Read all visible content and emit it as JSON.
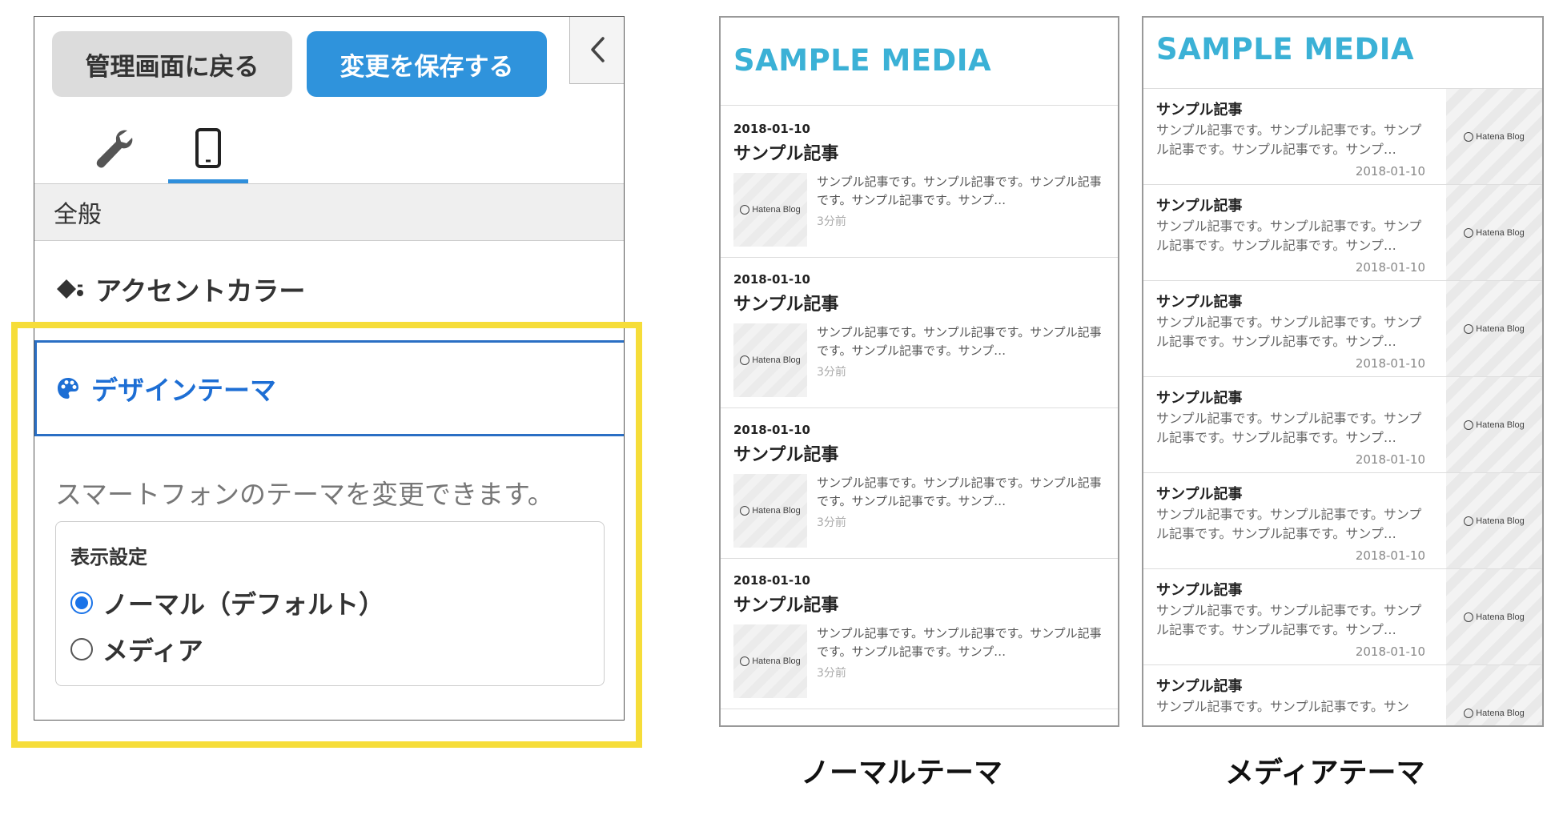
{
  "settings": {
    "back_label": "管理画面に戻る",
    "save_label": "変更を保存する",
    "tabs": [
      "wrench-icon",
      "smartphone-icon"
    ],
    "section_general": "全般",
    "accent_label": "アクセントカラー",
    "theme_label": "デザインテーマ",
    "theme_description": "スマートフォンのテーマを変更できます。",
    "display_title": "表示設定",
    "options": [
      {
        "label": "ノーマル（デフォルト）",
        "selected": true
      },
      {
        "label": "メディア",
        "selected": false
      }
    ],
    "colors": {
      "save": "#2f93dc",
      "active_tab": "#2f8fdc",
      "theme_border": "#2a6fc4",
      "highlight": "#f6dd39"
    }
  },
  "preview": {
    "brand": "SAMPLE MEDIA",
    "brand_color": "#3bb1d6",
    "normal": {
      "caption": "ノーマルテーマ",
      "items": [
        {
          "date": "2018-01-10",
          "title": "サンプル記事",
          "excerpt": "サンプル記事です。サンプル記事です。サンプル記事です。サンプル記事です。サンプ…",
          "ago": "3分前",
          "thumb": "Hatena Blog"
        },
        {
          "date": "2018-01-10",
          "title": "サンプル記事",
          "excerpt": "サンプル記事です。サンプル記事です。サンプル記事です。サンプル記事です。サンプ…",
          "ago": "3分前",
          "thumb": "Hatena Blog"
        },
        {
          "date": "2018-01-10",
          "title": "サンプル記事",
          "excerpt": "サンプル記事です。サンプル記事です。サンプル記事です。サンプル記事です。サンプ…",
          "ago": "3分前",
          "thumb": "Hatena Blog"
        },
        {
          "date": "2018-01-10",
          "title": "サンプル記事",
          "excerpt": "サンプル記事です。サンプル記事です。サンプル記事です。サンプル記事です。サンプ…",
          "ago": "3分前",
          "thumb": "Hatena Blog"
        }
      ]
    },
    "media": {
      "caption": "メディアテーマ",
      "items": [
        {
          "title": "サンプル記事",
          "excerpt": "サンプル記事です。サンプル記事です。サンプル記事です。サンプル記事です。サンプ…",
          "date": "2018-01-10",
          "thumb": "Hatena Blog"
        },
        {
          "title": "サンプル記事",
          "excerpt": "サンプル記事です。サンプル記事です。サンプル記事です。サンプル記事です。サンプ…",
          "date": "2018-01-10",
          "thumb": "Hatena Blog"
        },
        {
          "title": "サンプル記事",
          "excerpt": "サンプル記事です。サンプル記事です。サンプル記事です。サンプル記事です。サンプ…",
          "date": "2018-01-10",
          "thumb": "Hatena Blog"
        },
        {
          "title": "サンプル記事",
          "excerpt": "サンプル記事です。サンプル記事です。サンプル記事です。サンプル記事です。サンプ…",
          "date": "2018-01-10",
          "thumb": "Hatena Blog"
        },
        {
          "title": "サンプル記事",
          "excerpt": "サンプル記事です。サンプル記事です。サンプル記事です。サンプル記事です。サンプ…",
          "date": "2018-01-10",
          "thumb": "Hatena Blog"
        },
        {
          "title": "サンプル記事",
          "excerpt": "サンプル記事です。サンプル記事です。サンプル記事です。サンプル記事です。サンプ…",
          "date": "2018-01-10",
          "thumb": "Hatena Blog"
        },
        {
          "title": "サンプル記事",
          "excerpt": "サンプル記事です。サンプル記事です。サン",
          "date": "",
          "thumb": "Hatena Blog"
        }
      ]
    }
  }
}
